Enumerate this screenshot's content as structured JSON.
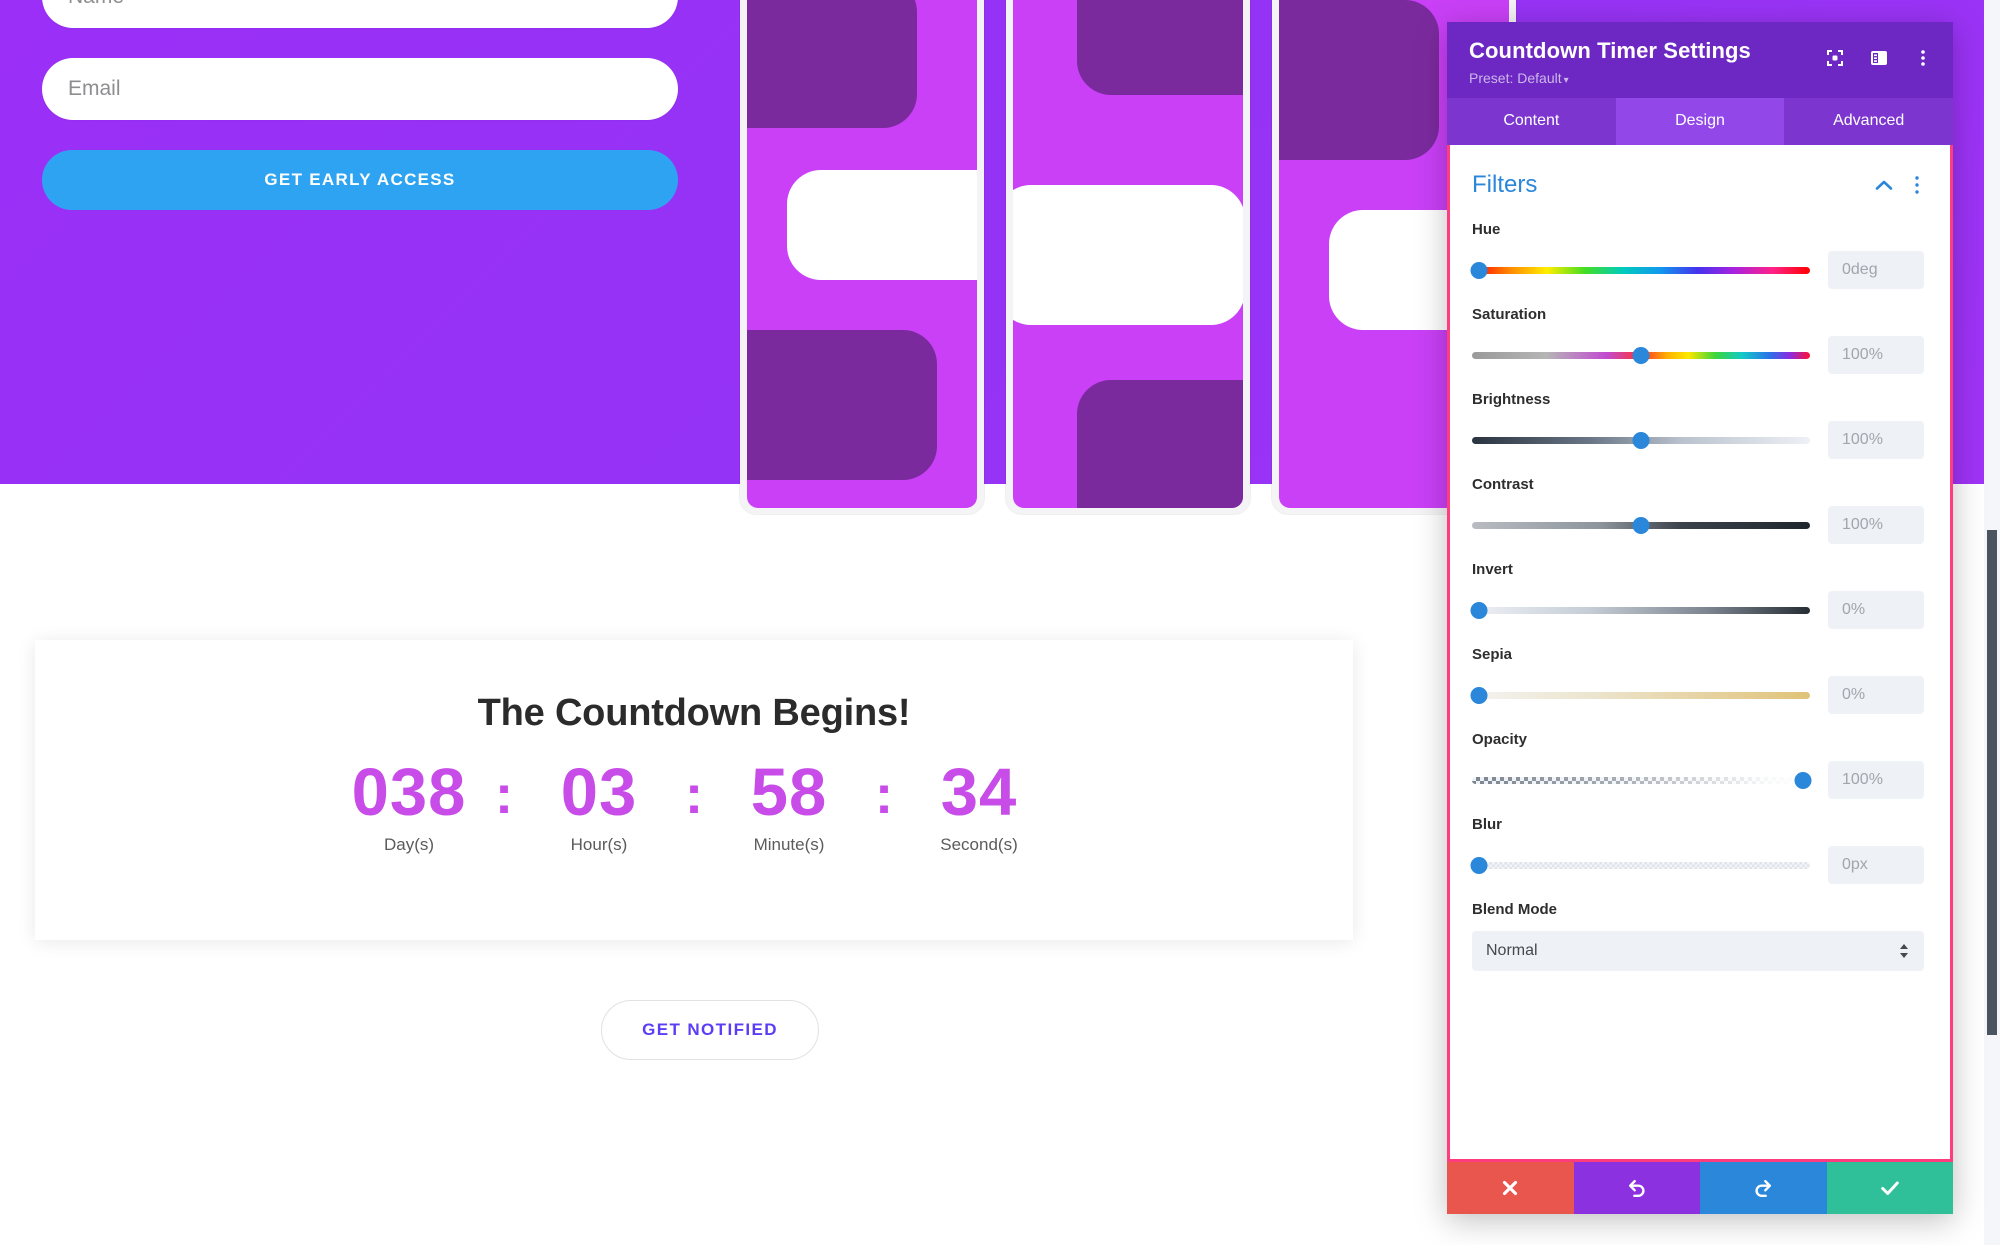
{
  "page": {
    "optin": {
      "name_placeholder": "Name",
      "email_placeholder": "Email",
      "cta_label": "GET EARLY ACCESS"
    },
    "countdown": {
      "title": "The Countdown Begins!",
      "separator": ":",
      "units": [
        {
          "value": "038",
          "label": "Day(s)"
        },
        {
          "value": "03",
          "label": "Hour(s)"
        },
        {
          "value": "58",
          "label": "Minute(s)"
        },
        {
          "value": "34",
          "label": "Second(s)"
        }
      ],
      "accent_color": "#c74ce8"
    },
    "notified_button": {
      "label": "GET NOTIFIED",
      "text_color": "#5b3df5"
    }
  },
  "modal": {
    "title": "Countdown Timer Settings",
    "preset_label": "Preset: Default",
    "preset_caret": "▾",
    "header_icons": [
      {
        "name": "expand-icon"
      },
      {
        "name": "layout-panel-icon"
      },
      {
        "name": "more-vertical-icon"
      }
    ],
    "tabs": [
      {
        "label": "Content",
        "active": false
      },
      {
        "label": "Design",
        "active": true
      },
      {
        "label": "Advanced",
        "active": false
      }
    ],
    "active_border_color": "#ff3c7d",
    "section": {
      "title": "Filters",
      "title_color": "#2b87da",
      "collapse_icon": "chevron-up-icon",
      "options_icon": "more-vertical-icon"
    },
    "controls": [
      {
        "label": "Hue",
        "value": "0deg",
        "percent": 2,
        "track": "hue"
      },
      {
        "label": "Saturation",
        "value": "100%",
        "percent": 50,
        "track": "sat"
      },
      {
        "label": "Brightness",
        "value": "100%",
        "percent": 50,
        "track": "bri"
      },
      {
        "label": "Contrast",
        "value": "100%",
        "percent": 50,
        "track": "con"
      },
      {
        "label": "Invert",
        "value": "0%",
        "percent": 2,
        "track": "inv"
      },
      {
        "label": "Sepia",
        "value": "0%",
        "percent": 2,
        "track": "sep"
      },
      {
        "label": "Opacity",
        "value": "100%",
        "percent": 98,
        "track": "opa"
      },
      {
        "label": "Blur",
        "value": "0px",
        "percent": 2,
        "track": "blur"
      }
    ],
    "blend_mode": {
      "label": "Blend Mode",
      "value": "Normal",
      "stepper_icon": "updown-arrows-icon"
    },
    "footer_buttons": [
      {
        "name": "cancel-button",
        "icon": "close-icon",
        "color": "#e8564d"
      },
      {
        "name": "undo-button",
        "icon": "undo-icon",
        "color": "#8b31e0"
      },
      {
        "name": "redo-button",
        "icon": "redo-icon",
        "color": "#2b87da"
      },
      {
        "name": "save-button",
        "icon": "check-icon",
        "color": "#2fc09a"
      }
    ]
  }
}
